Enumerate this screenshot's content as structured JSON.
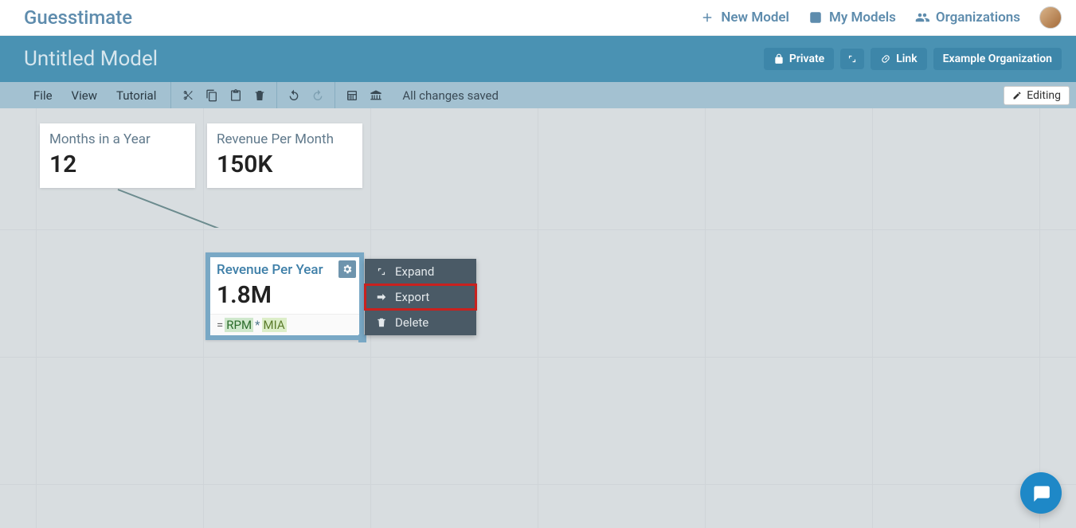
{
  "brand": "Guesstimate",
  "topnav": {
    "new_model": "New Model",
    "my_models": "My Models",
    "organizations": "Organizations"
  },
  "titlebar": {
    "model_title": "Untitled Model",
    "private": "Private",
    "link": "Link",
    "org": "Example Organization"
  },
  "toolbar": {
    "file": "File",
    "view": "View",
    "tutorial": "Tutorial",
    "save_status": "All changes saved",
    "editing": "Editing"
  },
  "cards": {
    "months": {
      "title": "Months in a Year",
      "value": "12"
    },
    "revpm": {
      "title": "Revenue Per Month",
      "value": "150K"
    },
    "revpy": {
      "title": "Revenue Per Year",
      "value": "1.8M",
      "formula_eq": "=",
      "formula_tok1": "RPM",
      "formula_op": "*",
      "formula_tok2": "MIA"
    }
  },
  "ctx": {
    "expand": "Expand",
    "export": "Export",
    "delete": "Delete"
  }
}
